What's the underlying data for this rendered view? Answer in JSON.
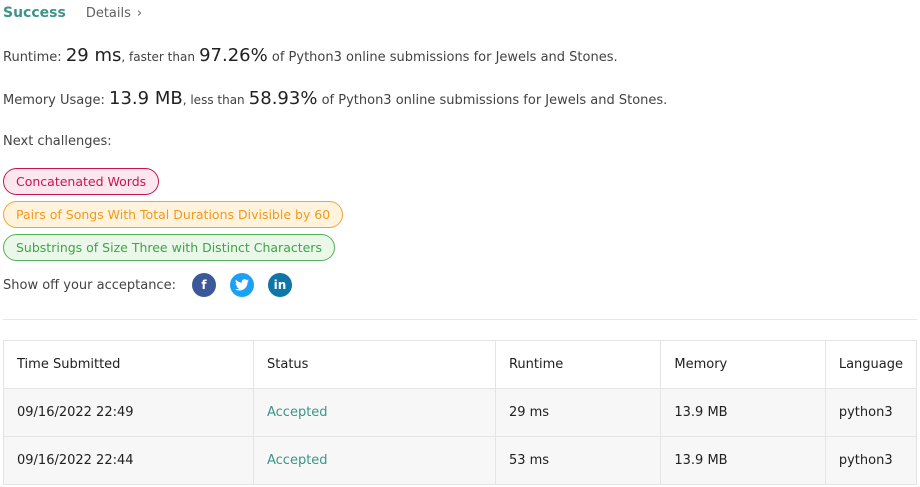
{
  "header": {
    "status": "Success",
    "details_label": "Details",
    "chevron": "›"
  },
  "runtime": {
    "label": "Runtime:",
    "value": "29 ms",
    "mid": ", faster than",
    "percent": "97.26%",
    "suffix": "of Python3 online submissions for Jewels and Stones."
  },
  "memory": {
    "label": "Memory Usage:",
    "value": "13.9 MB",
    "mid": ", less than",
    "percent": "58.93%",
    "suffix": "of Python3 online submissions for Jewels and Stones."
  },
  "next": {
    "label": "Next challenges:",
    "items": [
      "Concatenated Words",
      "Pairs of Songs With Total Durations Divisible by 60",
      "Substrings of Size Three with Distinct Characters"
    ]
  },
  "share": {
    "label": "Show off your acceptance:",
    "icons": [
      "facebook-icon",
      "twitter-icon",
      "linkedin-icon"
    ],
    "glyphs": [
      "f",
      "t",
      "in"
    ]
  },
  "table": {
    "headers": [
      "Time Submitted",
      "Status",
      "Runtime",
      "Memory",
      "Language"
    ],
    "rows": [
      [
        "09/16/2022 22:49",
        "Accepted",
        "29 ms",
        "13.9 MB",
        "python3"
      ],
      [
        "09/16/2022 22:44",
        "Accepted",
        "53 ms",
        "13.9 MB",
        "python3"
      ]
    ]
  },
  "colors": {
    "accent": "#3d9488",
    "hard": "#c7144f",
    "medium": "#f09a1c",
    "easy": "#3fa34a"
  }
}
